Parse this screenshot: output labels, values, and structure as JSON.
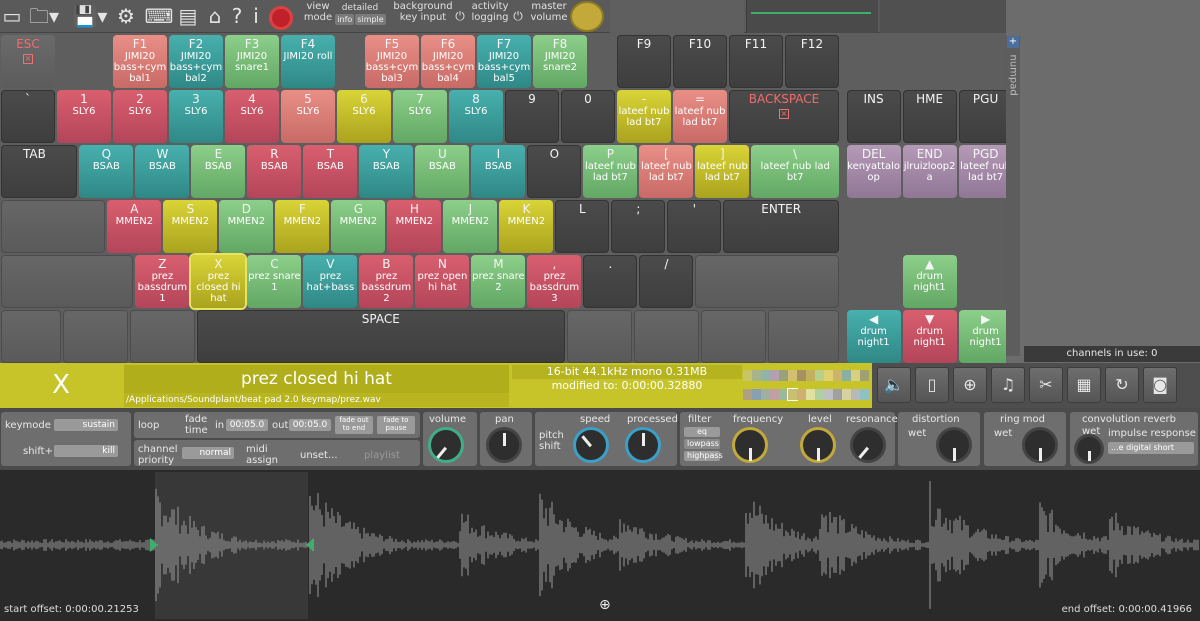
{
  "toolbar": {
    "view_mode": "view\nmode",
    "view_detailed": "detailed",
    "view_info": "info",
    "view_simple": "simple",
    "background_key_input": "background\nkey input",
    "activity_logging": "activity\nlogging",
    "master_volume": "master\nvolume"
  },
  "keys": [
    {
      "id": "ESC",
      "label": "ESC",
      "slot": "",
      "style": "esc",
      "red": true,
      "x": true,
      "r": 0,
      "c": 0,
      "w": 1
    },
    {
      "id": "F1",
      "label": "F1",
      "slot": "JIMI20\nbass+cym\nbal1",
      "style": "salmon",
      "r": 0,
      "c": 2
    },
    {
      "id": "F2",
      "label": "F2",
      "slot": "JIMI20\nbass+cym\nbal2",
      "style": "teal",
      "r": 0,
      "c": 3
    },
    {
      "id": "F3",
      "label": "F3",
      "slot": "JIMI20\nsnare1",
      "style": "green",
      "r": 0,
      "c": 4
    },
    {
      "id": "F4",
      "label": "F4",
      "slot": "JIMI20 roll",
      "style": "teal",
      "r": 0,
      "c": 5
    },
    {
      "id": "F5",
      "label": "F5",
      "slot": "JIMI20\nbass+cym\nbal3",
      "style": "salmon",
      "r": 0,
      "c": 6.5
    },
    {
      "id": "F6",
      "label": "F6",
      "slot": "JIMI20\nbass+cym\nbal4",
      "style": "salmon",
      "r": 0,
      "c": 7.5
    },
    {
      "id": "F7",
      "label": "F7",
      "slot": "JIMI20\nbass+cym\nbal5",
      "style": "teal",
      "r": 0,
      "c": 8.5
    },
    {
      "id": "F8",
      "label": "F8",
      "slot": "JIMI20\nsnare2",
      "style": "green",
      "r": 0,
      "c": 9.5
    },
    {
      "id": "F9",
      "label": "F9",
      "slot": "",
      "style": "dark",
      "r": 0,
      "c": 11
    },
    {
      "id": "F10",
      "label": "F10",
      "slot": "",
      "style": "dark",
      "r": 0,
      "c": 12
    },
    {
      "id": "F11",
      "label": "F11",
      "slot": "",
      "style": "dark",
      "r": 0,
      "c": 13
    },
    {
      "id": "F12",
      "label": "F12",
      "slot": "",
      "style": "dark",
      "r": 0,
      "c": 14
    },
    {
      "id": "BQ",
      "label": "`",
      "slot": "",
      "style": "dark",
      "r": 1,
      "c": 0
    },
    {
      "id": "N1",
      "label": "1",
      "slot": "SLY6",
      "style": "red",
      "r": 1,
      "c": 1
    },
    {
      "id": "N2",
      "label": "2",
      "slot": "SLY6",
      "style": "red",
      "r": 1,
      "c": 2
    },
    {
      "id": "N3",
      "label": "3",
      "slot": "SLY6",
      "style": "teal",
      "r": 1,
      "c": 3
    },
    {
      "id": "N4",
      "label": "4",
      "slot": "SLY6",
      "style": "red",
      "r": 1,
      "c": 4
    },
    {
      "id": "N5",
      "label": "5",
      "slot": "SLY6",
      "style": "salmon",
      "r": 1,
      "c": 5
    },
    {
      "id": "N6",
      "label": "6",
      "slot": "SLY6",
      "style": "yellow",
      "r": 1,
      "c": 6
    },
    {
      "id": "N7",
      "label": "7",
      "slot": "SLY6",
      "style": "green",
      "r": 1,
      "c": 7
    },
    {
      "id": "N8",
      "label": "8",
      "slot": "SLY6",
      "style": "teal",
      "r": 1,
      "c": 8
    },
    {
      "id": "N9",
      "label": "9",
      "slot": "",
      "style": "dark",
      "r": 1,
      "c": 9
    },
    {
      "id": "N0",
      "label": "0",
      "slot": "",
      "style": "dark",
      "r": 1,
      "c": 10
    },
    {
      "id": "MIN",
      "label": "-",
      "slot": "lateef nub\nlad bt7",
      "style": "yellow",
      "r": 1,
      "c": 11
    },
    {
      "id": "EQL",
      "label": "=",
      "slot": "lateef nub\nlad bt7",
      "style": "salmon",
      "r": 1,
      "c": 12
    },
    {
      "id": "BKSP",
      "label": "BACKSPACE",
      "slot": "",
      "style": "dark",
      "red": true,
      "x": true,
      "r": 1,
      "c": 13,
      "w": 2
    },
    {
      "id": "TAB",
      "label": "TAB",
      "slot": "",
      "style": "dark",
      "r": 2,
      "c": 0,
      "w": 1.4,
      "left": true
    },
    {
      "id": "Q",
      "label": "Q",
      "slot": "BSAB",
      "style": "teal",
      "r": 2,
      "c": 1.4
    },
    {
      "id": "W",
      "label": "W",
      "slot": "BSAB",
      "style": "teal",
      "r": 2,
      "c": 2.4
    },
    {
      "id": "E",
      "label": "E",
      "slot": "BSAB",
      "style": "green",
      "r": 2,
      "c": 3.4
    },
    {
      "id": "R",
      "label": "R",
      "slot": "BSAB",
      "style": "red",
      "r": 2,
      "c": 4.4
    },
    {
      "id": "T",
      "label": "T",
      "slot": "BSAB",
      "style": "red",
      "r": 2,
      "c": 5.4
    },
    {
      "id": "Y",
      "label": "Y",
      "slot": "BSAB",
      "style": "teal",
      "r": 2,
      "c": 6.4
    },
    {
      "id": "U",
      "label": "U",
      "slot": "BSAB",
      "style": "green",
      "r": 2,
      "c": 7.4
    },
    {
      "id": "I",
      "label": "I",
      "slot": "BSAB",
      "style": "teal",
      "r": 2,
      "c": 8.4
    },
    {
      "id": "O",
      "label": "O",
      "slot": "",
      "style": "dark",
      "r": 2,
      "c": 9.4
    },
    {
      "id": "P",
      "label": "P",
      "slot": "lateef nub\nlad bt7",
      "style": "green",
      "r": 2,
      "c": 10.4
    },
    {
      "id": "LBR",
      "label": "[",
      "slot": "lateef nub\nlad bt7",
      "style": "salmon",
      "r": 2,
      "c": 11.4
    },
    {
      "id": "RBR",
      "label": "]",
      "slot": "lateef nub\nlad bt7",
      "style": "yellow",
      "r": 2,
      "c": 12.4
    },
    {
      "id": "BSL",
      "label": "\\",
      "slot": "lateef nub lad\nbt7",
      "style": "green",
      "r": 2,
      "c": 13.4,
      "w": 1.6
    },
    {
      "id": "CAPS",
      "label": "",
      "slot": "",
      "style": "empty",
      "r": 3,
      "c": 0,
      "w": 1.9
    },
    {
      "id": "A",
      "label": "A",
      "slot": "MMEN2",
      "style": "red",
      "r": 3,
      "c": 1.9
    },
    {
      "id": "S",
      "label": "S",
      "slot": "MMEN2",
      "style": "yellow",
      "r": 3,
      "c": 2.9
    },
    {
      "id": "D",
      "label": "D",
      "slot": "MMEN2",
      "style": "green",
      "r": 3,
      "c": 3.9
    },
    {
      "id": "F",
      "label": "F",
      "slot": "MMEN2",
      "style": "yellow",
      "r": 3,
      "c": 4.9
    },
    {
      "id": "G",
      "label": "G",
      "slot": "MMEN2",
      "style": "green",
      "r": 3,
      "c": 5.9
    },
    {
      "id": "H",
      "label": "H",
      "slot": "MMEN2",
      "style": "red",
      "r": 3,
      "c": 6.9
    },
    {
      "id": "J",
      "label": "J",
      "slot": "MMEN2",
      "style": "green",
      "r": 3,
      "c": 7.9
    },
    {
      "id": "K",
      "label": "K",
      "slot": "MMEN2",
      "style": "yellow",
      "r": 3,
      "c": 8.9
    },
    {
      "id": "L",
      "label": "L",
      "slot": "",
      "style": "dark",
      "r": 3,
      "c": 9.9
    },
    {
      "id": "SEMI",
      "label": ";",
      "slot": "",
      "style": "dark",
      "r": 3,
      "c": 10.9
    },
    {
      "id": "APOS",
      "label": "'",
      "slot": "",
      "style": "dark",
      "r": 3,
      "c": 11.9
    },
    {
      "id": "ENTER",
      "label": "ENTER",
      "slot": "",
      "style": "dark",
      "r": 3,
      "c": 12.9,
      "w": 2.1
    },
    {
      "id": "LSHIFT",
      "label": "",
      "slot": "",
      "style": "empty",
      "r": 4,
      "c": 0,
      "w": 2.4
    },
    {
      "id": "Z",
      "label": "Z",
      "slot": "prez\nbassdrum\n1",
      "style": "red",
      "r": 4,
      "c": 2.4
    },
    {
      "id": "X",
      "label": "X",
      "slot": "prez\nclosed hi\nhat",
      "style": "yellow",
      "sel": true,
      "r": 4,
      "c": 3.4
    },
    {
      "id": "C",
      "label": "C",
      "slot": "prez snare\n1",
      "style": "green",
      "r": 4,
      "c": 4.4
    },
    {
      "id": "V",
      "label": "V",
      "slot": "prez\nhat+bass",
      "style": "teal",
      "r": 4,
      "c": 5.4
    },
    {
      "id": "B",
      "label": "B",
      "slot": "prez\nbassdrum\n2",
      "style": "red",
      "r": 4,
      "c": 6.4
    },
    {
      "id": "N",
      "label": "N",
      "slot": "prez open\nhi hat",
      "style": "red",
      "r": 4,
      "c": 7.4
    },
    {
      "id": "M",
      "label": "M",
      "slot": "prez snare\n2",
      "style": "green",
      "r": 4,
      "c": 8.4
    },
    {
      "id": "COMMA",
      "label": ",",
      "slot": "prez\nbassdrum\n3",
      "style": "red",
      "r": 4,
      "c": 9.4
    },
    {
      "id": "DOT",
      "label": ".",
      "slot": "",
      "style": "dark",
      "r": 4,
      "c": 10.4
    },
    {
      "id": "SLASH",
      "label": "/",
      "slot": "",
      "style": "dark",
      "r": 4,
      "c": 11.4
    },
    {
      "id": "RSHIFT",
      "label": "",
      "slot": "",
      "style": "empty",
      "r": 4,
      "c": 12.4,
      "w": 2.6
    },
    {
      "id": "LCTRL",
      "label": "",
      "slot": "",
      "style": "empty",
      "r": 5,
      "c": 0,
      "w": 1.1
    },
    {
      "id": "LWIN",
      "label": "",
      "slot": "",
      "style": "empty",
      "r": 5,
      "c": 1.1,
      "w": 1.2
    },
    {
      "id": "LALT",
      "label": "",
      "slot": "",
      "style": "empty",
      "r": 5,
      "c": 2.3,
      "w": 1.2
    },
    {
      "id": "SPACE",
      "label": "SPACE",
      "slot": "",
      "style": "dark",
      "r": 5,
      "c": 3.5,
      "w": 6.6
    },
    {
      "id": "RALT",
      "label": "",
      "slot": "",
      "style": "empty",
      "r": 5,
      "c": 10.1,
      "w": 1.2
    },
    {
      "id": "RWIN",
      "label": "",
      "slot": "",
      "style": "empty",
      "r": 5,
      "c": 11.3,
      "w": 1.2
    },
    {
      "id": "MENU",
      "label": "",
      "slot": "",
      "style": "empty",
      "r": 5,
      "c": 12.5,
      "w": 1.2
    },
    {
      "id": "RCTRL",
      "label": "",
      "slot": "",
      "style": "empty",
      "r": 5,
      "c": 13.7,
      "w": 1.3
    },
    {
      "id": "INS",
      "label": "INS",
      "slot": "",
      "style": "dark",
      "r": 1,
      "c": 15.1
    },
    {
      "id": "HME",
      "label": "HME",
      "slot": "",
      "style": "dark",
      "r": 1,
      "c": 16.1
    },
    {
      "id": "PGU",
      "label": "PGU",
      "slot": "",
      "style": "dark",
      "r": 1,
      "c": 17.1
    },
    {
      "id": "DEL",
      "label": "DEL",
      "slot": "kenyattalo\nop",
      "style": "mauve",
      "r": 2,
      "c": 15.1
    },
    {
      "id": "END",
      "label": "END",
      "slot": "jlruizloop2\na",
      "style": "mauve",
      "r": 2,
      "c": 16.1
    },
    {
      "id": "PGD",
      "label": "PGD",
      "slot": "lateef nub\nlad bt7",
      "style": "mauve",
      "r": 2,
      "c": 17.1
    },
    {
      "id": "UP",
      "label": "▲",
      "slot": "drum\nnight1",
      "style": "green",
      "r": 4,
      "c": 16.1
    },
    {
      "id": "LEFT",
      "label": "◀",
      "slot": "drum\nnight1",
      "style": "teal",
      "r": 5,
      "c": 15.1
    },
    {
      "id": "DOWN",
      "label": "▼",
      "slot": "drum\nnight1",
      "style": "red",
      "r": 5,
      "c": 16.1
    },
    {
      "id": "RIGHT",
      "label": "▶",
      "slot": "drum\nnight1",
      "style": "green",
      "r": 5,
      "c": 17.1
    }
  ],
  "numpad_label": "numpad",
  "channels": {
    "label": "channels in use:",
    "value": "0"
  },
  "slot": {
    "key": "X",
    "name": "prez closed hi hat",
    "path": "/Applications/Soundplant/beat pad 2.0 keymap/prez.wav",
    "format": "16-bit 44.1kHz mono 0.31MB",
    "modified": "modified to: 0:00:00.32880"
  },
  "controls": {
    "keymode_label": "keymode",
    "keymode_value": "sustain",
    "shift_label": "shift+",
    "shift_value": "kill",
    "loop_label": "loop",
    "fade_time_label": "fade\ntime",
    "fade_in_label": "in",
    "fade_in_value": "00:05.0",
    "fade_out_label": "out",
    "fade_out_value": "00:05.0",
    "fade_out_to_end": "fade out\nto end",
    "fade_to_pause": "fade to\npause",
    "channel_priority_label": "channel\npriority",
    "channel_priority_value": "normal",
    "midi_assign_label": "midi\nassign",
    "midi_assign_value": "unset...",
    "playlist_label": "playlist",
    "volume_label": "volume",
    "pan_label": "pan",
    "pitch_shift_label": "pitch\nshift",
    "speed_label": "speed",
    "processed_label": "processed",
    "filter_label": "filter",
    "filter_eq": "eq",
    "filter_lowpass": "lowpass",
    "filter_highpass": "highpass",
    "frequency_label": "frequency",
    "level_label": "level",
    "resonance_label": "resonance",
    "distortion_label": "distortion",
    "distortion_wet": "wet",
    "ring_mod_label": "ring mod",
    "ring_mod_wet": "wet",
    "convolution_label": "convolution reverb",
    "convolution_wet": "wet",
    "impulse_label": "impulse response",
    "impulse_value": "...e digital short"
  },
  "waveform": {
    "start_offset": "start offset: 0:00:00.21253",
    "end_offset": "end offset: 0:00:00.41966"
  },
  "colors": {
    "info_bar": "#c7c42a",
    "red": "#d85f6e",
    "teal": "#48b0ad",
    "green": "#8ccf8a",
    "yellow": "#d9d437"
  }
}
